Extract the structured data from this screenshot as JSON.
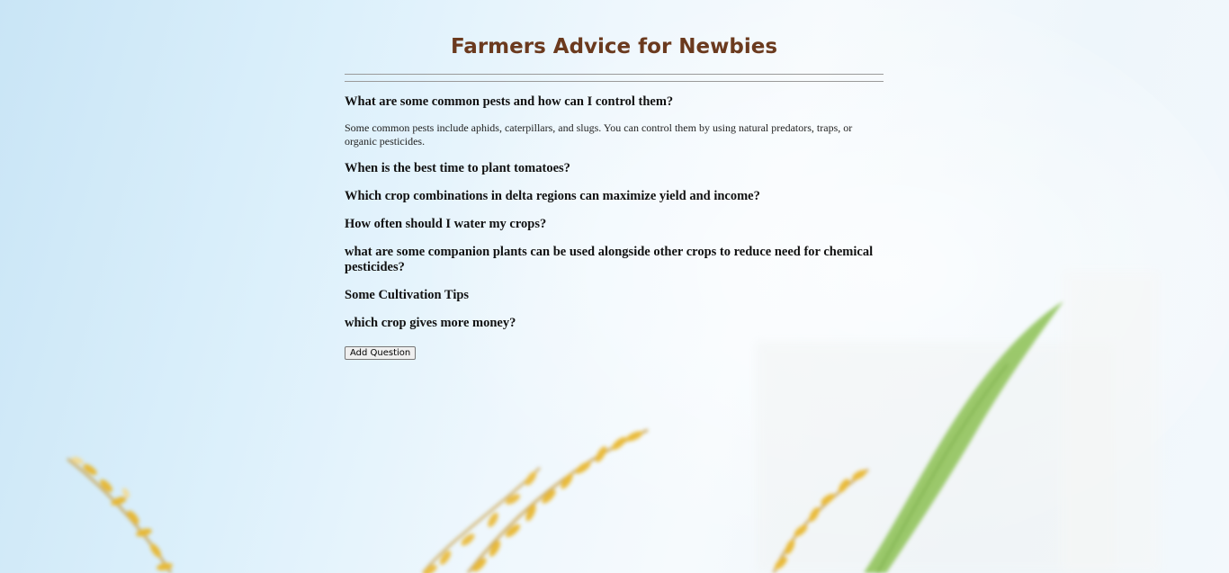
{
  "page": {
    "title": "Farmers Advice for Newbies"
  },
  "faq": {
    "q1": "What are some common pests and how can I control them?",
    "a1": "Some common pests include aphids, caterpillars, and slugs. You can control them by using natural predators, traps, or organic pesticides.",
    "q2": "When is the best time to plant tomatoes?",
    "q3": "Which crop combinations in delta regions can maximize yield and income?",
    "q4": "How often should I water my crops?",
    "q5": "what are some companion plants can be used alongside other crops to reduce need for chemical pesticides?",
    "q6": "Some Cultivation Tips",
    "q7": "which crop gives more money?"
  },
  "actions": {
    "add_question_label": "Add Question"
  },
  "colors": {
    "title": "#6b3a1e",
    "background_sky": "#dcf0fb",
    "grain_accent": "#e8b323",
    "stalk_green": "#7cb342"
  }
}
